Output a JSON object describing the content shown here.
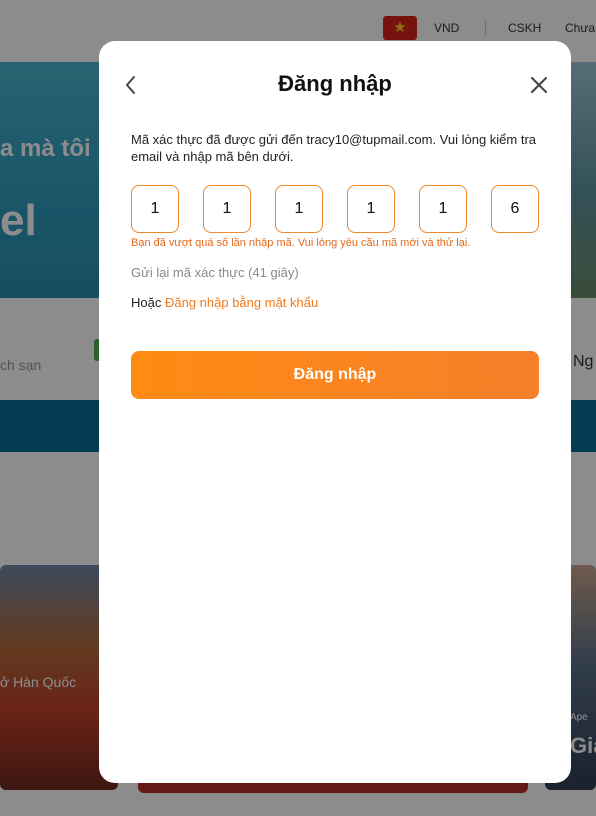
{
  "background": {
    "header": {
      "currency": "VND",
      "support": "CSKH",
      "more": "Chưa"
    },
    "hero": {
      "line1": "a mà tôi",
      "line2": "el"
    },
    "search": {
      "placeholder": "ch sạn",
      "right_label": "Ng"
    },
    "cards": {
      "left_label": "ở Hàn Quốc",
      "right_small": "Ape",
      "right_label": "Gia"
    }
  },
  "modal": {
    "title": "Đăng nhập",
    "message": "Mã xác thực đã được gửi đến tracy10@tupmail.com. Vui lòng kiểm tra email và nhập mã bên dưới.",
    "otp_digits": [
      "1",
      "1",
      "1",
      "1",
      "1",
      "6"
    ],
    "error": "Bạn đã vượt quá số lần nhập mã. Vui lòng yêu cầu mã mới và thử lại.",
    "resend": "Gửi lại mã xác thực (41  giây)",
    "alt_prefix": "Hoặc",
    "alt_link": "Đăng nhập bằng mật khẩu",
    "submit": "Đăng nhập",
    "icons": {
      "back": "chevron-left-icon",
      "close": "close-icon"
    }
  },
  "colors": {
    "accent": "#f07b1d",
    "button_start": "#ff8b14",
    "button_end": "#f57f2a",
    "error": "#e36a1b",
    "overlay": "rgba(0,0,0,0.45)"
  }
}
